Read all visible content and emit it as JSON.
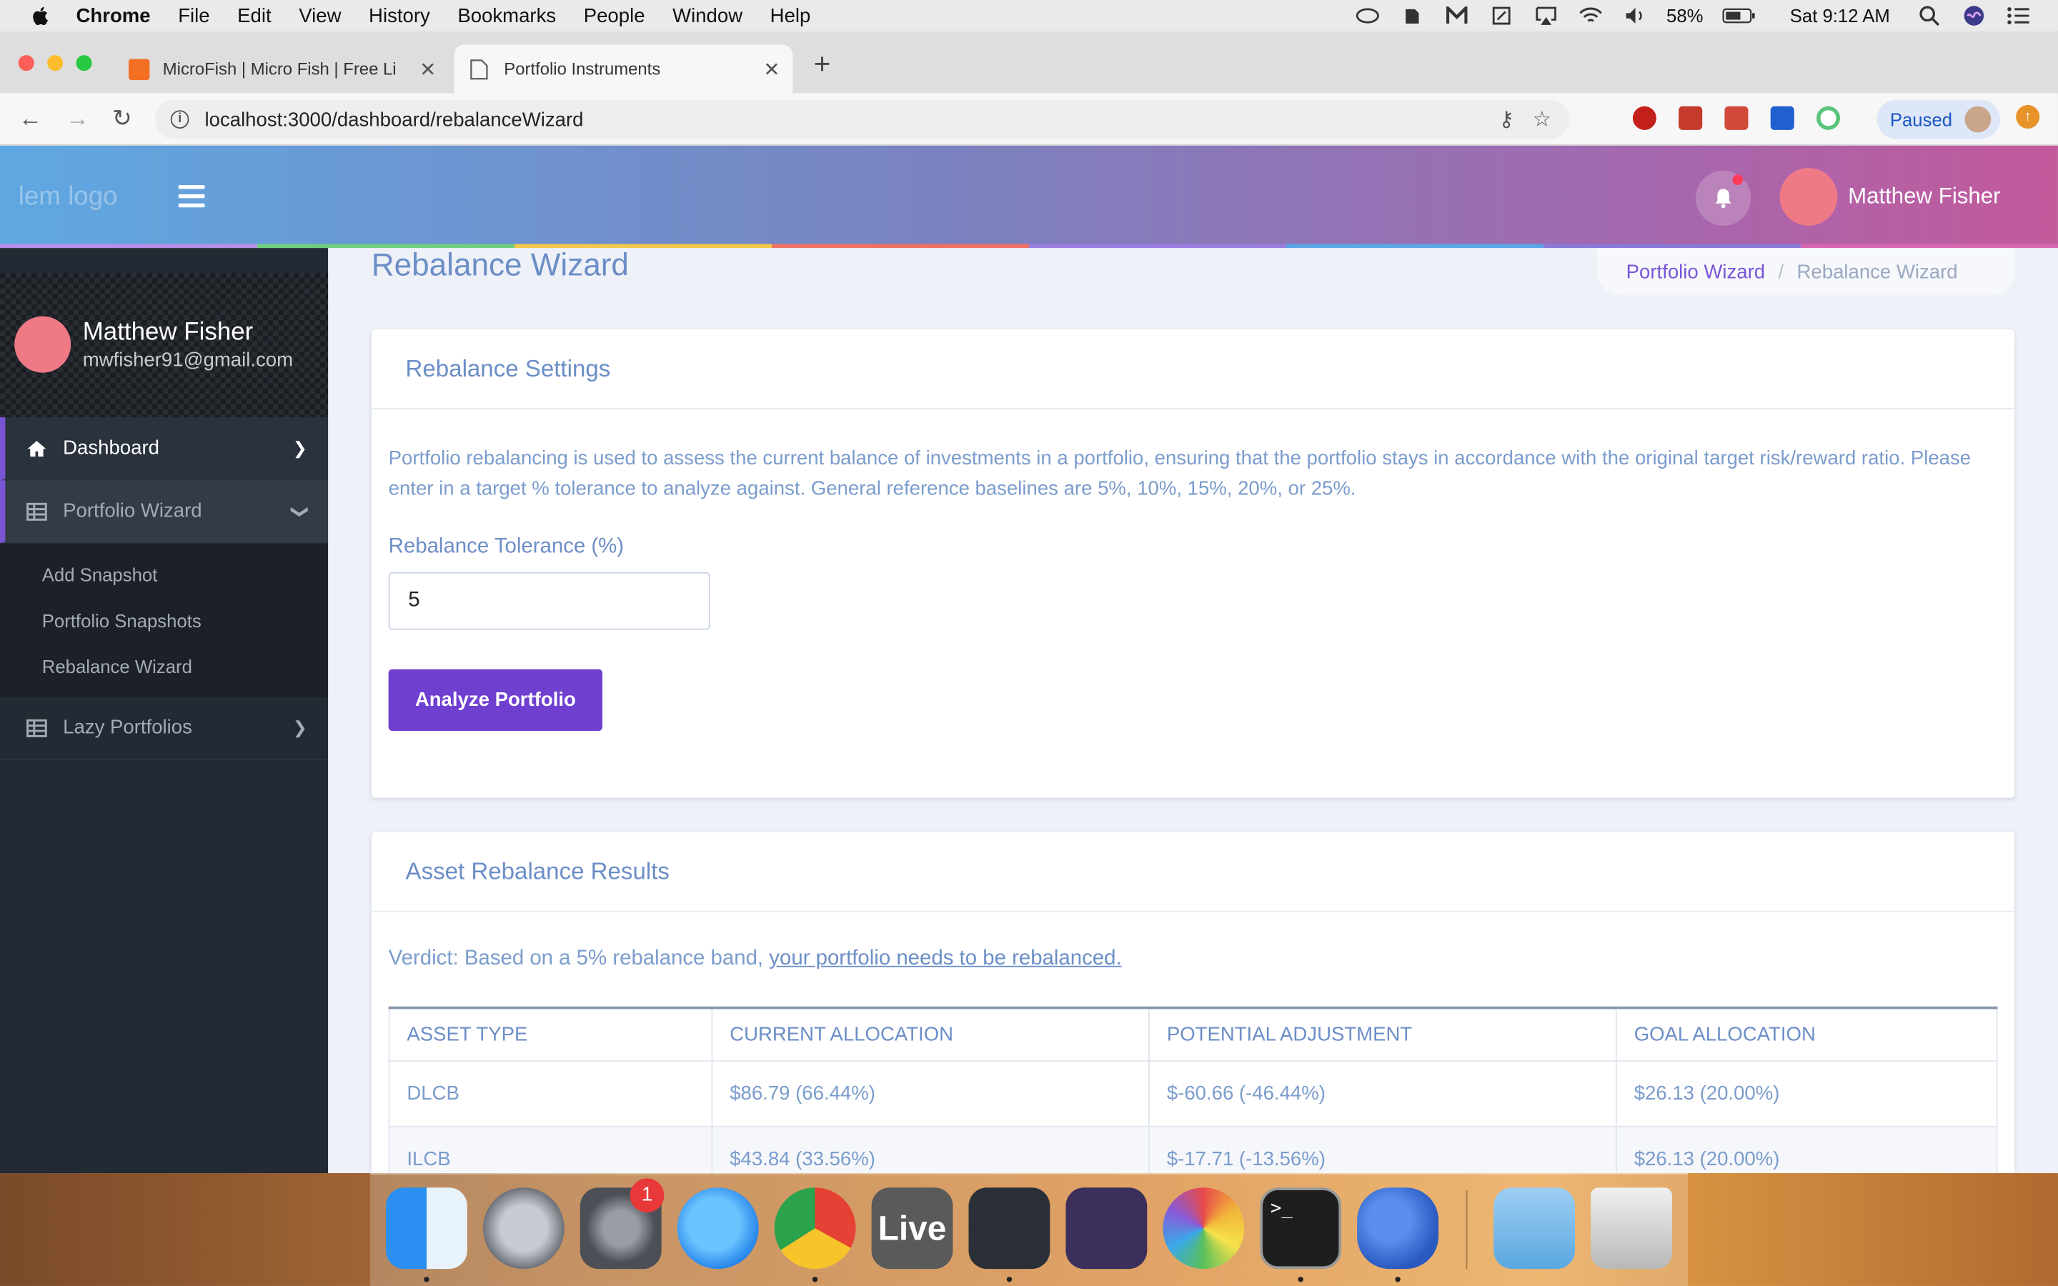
{
  "menubar": {
    "app": "Chrome",
    "items": [
      "File",
      "Edit",
      "View",
      "History",
      "Bookmarks",
      "People",
      "Window",
      "Help"
    ],
    "battery": "58%",
    "clock": "Sat 9:12 AM"
  },
  "tabs": [
    {
      "title": "MicroFish | Micro Fish | Free Li",
      "active": false
    },
    {
      "title": "Portfolio Instruments",
      "active": true
    }
  ],
  "address": {
    "url": "localhost:3000/dashboard/rebalanceWizard"
  },
  "profile": {
    "status": "Paused"
  },
  "header": {
    "logo_alt": "lem logo",
    "username": "Matthew Fisher"
  },
  "sidebar": {
    "user": {
      "name": "Matthew Fisher",
      "email": "mwfisher91@gmail.com"
    },
    "items": [
      {
        "label": "Dashboard",
        "icon": "home-icon"
      },
      {
        "label": "Portfolio Wizard",
        "icon": "table-icon",
        "children": [
          "Add Snapshot",
          "Portfolio Snapshots",
          "Rebalance Wizard"
        ]
      },
      {
        "label": "Lazy Portfolios",
        "icon": "table-icon"
      }
    ]
  },
  "page": {
    "title": "Rebalance Wizard",
    "breadcrumb": [
      "Portfolio Wizard",
      "Rebalance Wizard"
    ]
  },
  "settings": {
    "title": "Rebalance Settings",
    "description": "Portfolio rebalancing is used to assess the current balance of investments in a portfolio, ensuring that the portfolio stays in accordance with the original target risk/reward ratio. Please enter in a target % tolerance to analyze against. General reference baselines are 5%, 10%, 15%, 20%, or 25%.",
    "tolerance_label": "Rebalance Tolerance (%)",
    "tolerance_value": "5",
    "analyze_label": "Analyze Portfolio"
  },
  "results": {
    "title": "Asset Rebalance Results",
    "verdict_prefix": "Verdict: Based on a 5% rebalance band, ",
    "verdict_link": "your portfolio needs to be rebalanced.",
    "headers": [
      "ASSET TYPE",
      "CURRENT ALLOCATION",
      "POTENTIAL ADJUSTMENT",
      "GOAL ALLOCATION"
    ],
    "rows": [
      [
        "DLCB",
        "$86.79 (66.44%)",
        "$-60.66 (-46.44%)",
        "$26.13 (20.00%)"
      ],
      [
        "ILCB",
        "$43.84 (33.56%)",
        "$-17.71 (-13.56%)",
        "$26.13 (20.00%)"
      ]
    ]
  },
  "dock": {
    "apps": [
      "Finder",
      "Launchpad",
      "System Preferences",
      "Messages",
      "Chrome",
      "Ableton Live",
      "VS Code",
      "Visual Studio",
      "Color Picker",
      "Terminal",
      "TablePlus",
      "Downloads",
      "Trash"
    ],
    "badge": "1"
  },
  "colors": {
    "accent": "#7a55d6",
    "button": "#6f3fd0",
    "text": "#6c8ec7"
  }
}
